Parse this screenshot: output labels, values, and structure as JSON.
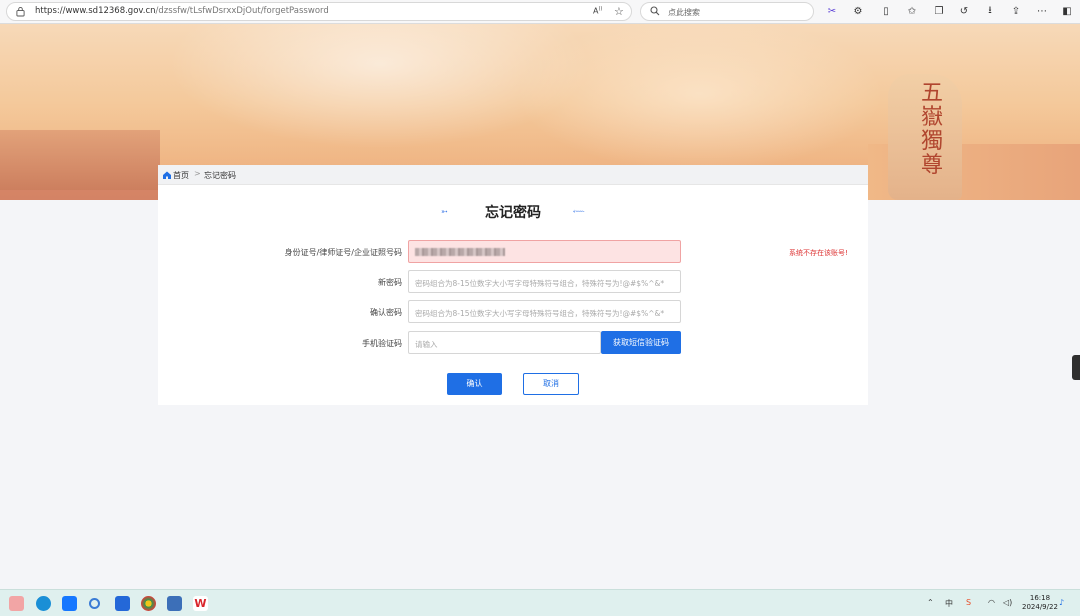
{
  "browser": {
    "url_prefix": "https://www.sd12368.gov.cn",
    "url_path": "/dzssfw/tLsfwDsrxxDjOut/forgetPassword",
    "read_aloud_label": "A",
    "search_placeholder": "点此搜索"
  },
  "breadcrumb": {
    "home_label": "首页",
    "separator": ">",
    "current_label": "忘记密码"
  },
  "page": {
    "title": "忘记密码",
    "title_deco_left": "➵",
    "title_deco_right": "⬳"
  },
  "form": {
    "id_label": "身份证号/律师证号/企业证照号码",
    "id_error": "系统不存在该账号!",
    "new_password_label": "新密码",
    "new_password_placeholder": "密码组合为8-15位数字大小写字母特殊符号组合，特殊符号为!@#$%^&*",
    "confirm_password_label": "确认密码",
    "confirm_password_placeholder": "密码组合为8-15位数字大小写字母特殊符号组合，特殊符号为!@#$%^&*",
    "sms_code_label": "手机验证码",
    "sms_code_placeholder": "请输入",
    "sms_button_label": "获取短信验证码",
    "ok_label": "确认",
    "cancel_label": "取消"
  },
  "banner": {
    "rock_text": "五嶽獨尊"
  },
  "taskbar": {
    "ime_label": "中",
    "time": "16:18",
    "date": "2024/9/22"
  },
  "colors": {
    "primary": "#1f6fe5",
    "error": "#dd3333",
    "error_bg": "#fde3e3"
  }
}
